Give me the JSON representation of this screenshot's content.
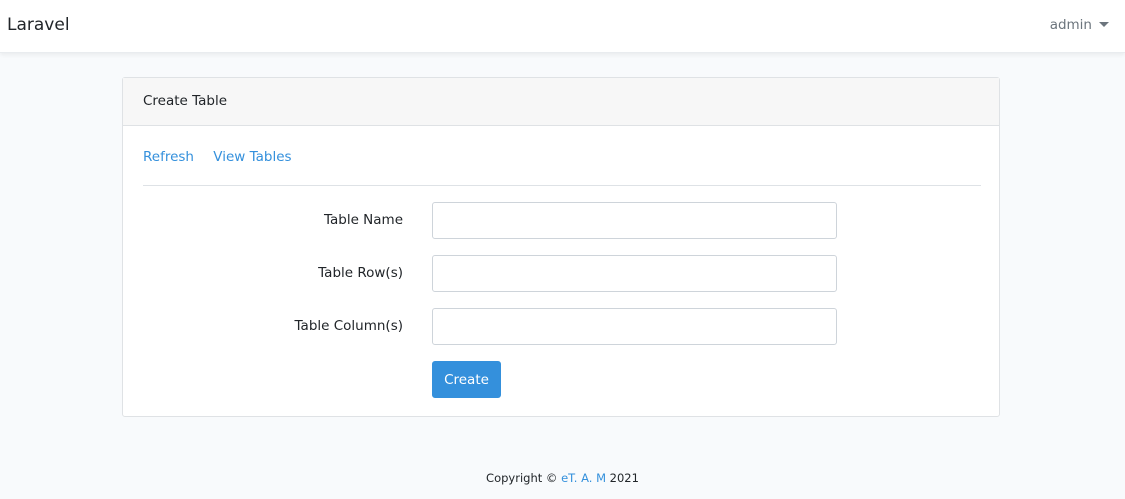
{
  "navbar": {
    "brand": "Laravel",
    "user_label": "admin",
    "caret_icon": "caret-down-icon"
  },
  "card": {
    "title": "Create Table",
    "links": {
      "refresh": "Refresh",
      "view_tables": "View Tables"
    },
    "form": {
      "table_name_label": "Table Name",
      "table_name_value": "",
      "table_rows_label": "Table Row(s)",
      "table_rows_value": "",
      "table_columns_label": "Table Column(s)",
      "table_columns_value": "",
      "submit_label": "Create"
    }
  },
  "footer": {
    "prefix": "Copyright ©",
    "link": "eT. A. M",
    "year": "2021"
  },
  "colors": {
    "accent": "#3490dc",
    "background": "#f8fafc",
    "card_header": "#f7f7f7"
  }
}
